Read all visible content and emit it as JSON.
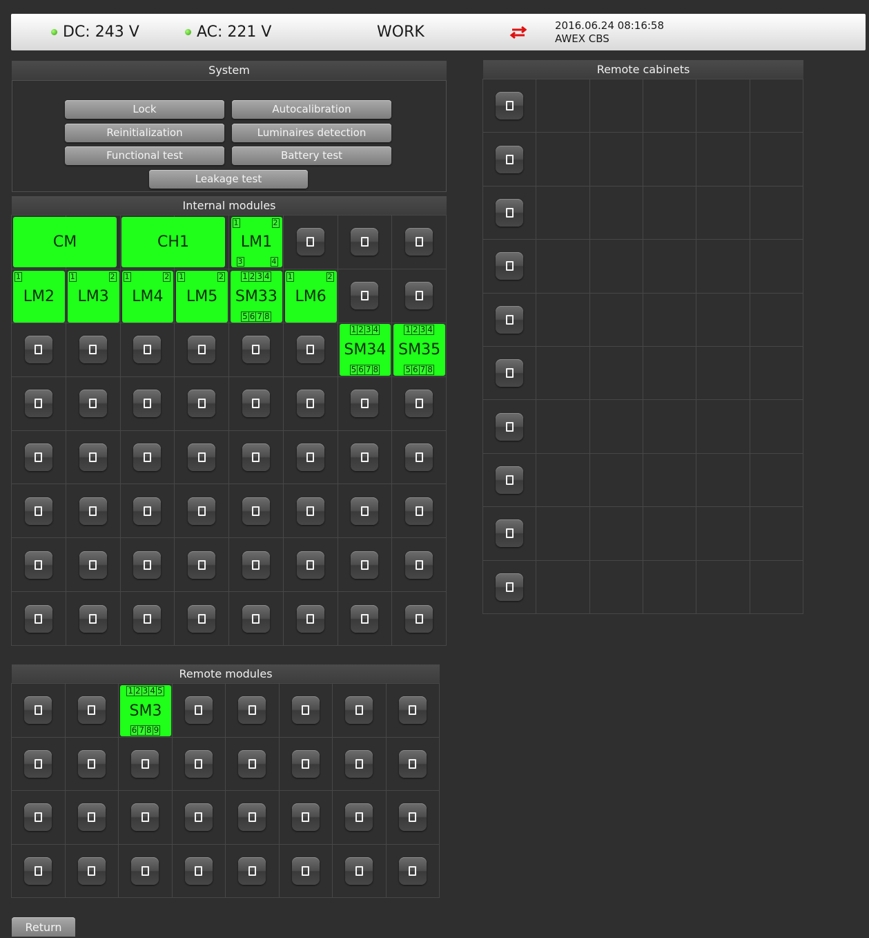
{
  "header": {
    "dc_label": "DC: 243 V",
    "ac_label": "AC: 221 V",
    "status": "WORK",
    "datetime": "2016.06.24 08:16:58",
    "device": "AWEX CBS",
    "led_color": "#2ea000",
    "arrow_color": "#e01010"
  },
  "system": {
    "title": "System",
    "buttons": {
      "lock": "Lock",
      "autocalibration": "Autocalibration",
      "reinitialization": "Reinitialization",
      "luminaires_detection": "Luminaires detection",
      "functional_test": "Functional test",
      "battery_test": "Battery test",
      "leakage_test": "Leakage test"
    }
  },
  "internal": {
    "title": "Internal modules",
    "modules": {
      "cm": {
        "label": "CM"
      },
      "ch1": {
        "label": "CH1"
      },
      "lm1": {
        "label": "LM1",
        "top": [
          "1",
          "2"
        ],
        "bottom": [
          "3",
          "4"
        ]
      },
      "lm2": {
        "label": "LM2",
        "top": [
          "1"
        ]
      },
      "lm3": {
        "label": "LM3",
        "top": [
          "1",
          "2"
        ]
      },
      "lm4": {
        "label": "LM4",
        "top": [
          "1",
          "2"
        ]
      },
      "lm5": {
        "label": "LM5",
        "top": [
          "1",
          "2"
        ]
      },
      "sm33": {
        "label": "SM33",
        "top": "1234",
        "bottom": "5678"
      },
      "lm6": {
        "label": "LM6",
        "top": [
          "1",
          "2"
        ]
      },
      "sm34": {
        "label": "SM34",
        "top": "1234",
        "bottom": "5678"
      },
      "sm35": {
        "label": "SM35",
        "top": "1234",
        "bottom": "5678"
      }
    },
    "module_color": "#1fff19"
  },
  "remote_modules": {
    "title": "Remote modules",
    "sm3": {
      "label": "SM3",
      "top": "12345",
      "bottom": "6789"
    }
  },
  "remote_cabinets": {
    "title": "Remote cabinets"
  },
  "footer": {
    "return_label": "Return"
  }
}
